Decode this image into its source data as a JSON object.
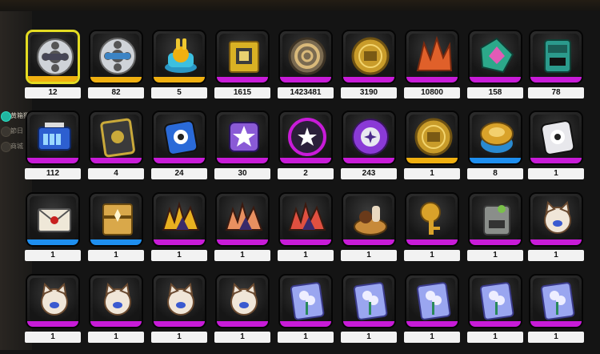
{
  "header": {
    "title": ""
  },
  "sidebar": {
    "items": [
      {
        "label": "黄箱獵人",
        "active": true,
        "icon": "teal-dot-icon"
      },
      {
        "label": "節日",
        "active": false,
        "icon": "dot-icon"
      },
      {
        "label": "商城",
        "active": false,
        "icon": "dot-icon"
      }
    ]
  },
  "colors": {
    "purple": "#c81bd8",
    "gold": "#f0b010",
    "blue": "#1e8ff0",
    "selected": "#e4dc22"
  },
  "inventory": {
    "items": [
      {
        "name": "film-reel-silver",
        "count": "12",
        "rarity": "gold",
        "selected": true,
        "icon": "film-reel-icon"
      },
      {
        "name": "film-reel-blue",
        "count": "82",
        "rarity": "gold",
        "icon": "film-reel-icon"
      },
      {
        "name": "bunny-cylinder",
        "count": "5",
        "rarity": "gold",
        "icon": "bunny-capsule-icon"
      },
      {
        "name": "gold-cube",
        "count": "1615",
        "rarity": "purple",
        "icon": "gold-cube-icon"
      },
      {
        "name": "spiral-coin",
        "count": "1423481",
        "rarity": "purple",
        "icon": "spiral-coin-icon"
      },
      {
        "name": "gold-coin",
        "count": "3190",
        "rarity": "purple",
        "icon": "gold-coin-icon"
      },
      {
        "name": "orange-crystal",
        "count": "10800",
        "rarity": "purple",
        "icon": "crystal-icon"
      },
      {
        "name": "teal-shard",
        "count": "158",
        "rarity": "purple",
        "icon": "shard-icon"
      },
      {
        "name": "teal-box",
        "count": "78",
        "rarity": "purple",
        "icon": "box-icon"
      },
      {
        "name": "battery-pack",
        "count": "112",
        "rarity": "purple",
        "icon": "battery-icon"
      },
      {
        "name": "dark-card",
        "count": "4",
        "rarity": "purple",
        "icon": "card-icon"
      },
      {
        "name": "blue-ticket",
        "count": "24",
        "rarity": "purple",
        "icon": "ticket-icon"
      },
      {
        "name": "star-cube",
        "count": "30",
        "rarity": "purple",
        "icon": "star-cube-icon"
      },
      {
        "name": "purple-disc",
        "count": "2",
        "rarity": "purple",
        "icon": "disc-icon"
      },
      {
        "name": "star-gear",
        "count": "243",
        "rarity": "purple",
        "icon": "gear-icon"
      },
      {
        "name": "hib-coin",
        "count": "1",
        "rarity": "gold",
        "icon": "gold-coin-icon"
      },
      {
        "name": "gold-can",
        "count": "8",
        "rarity": "blue",
        "icon": "can-icon"
      },
      {
        "name": "white-ticket",
        "count": "1",
        "rarity": "purple",
        "icon": "ticket-icon"
      },
      {
        "name": "envelope",
        "count": "1",
        "rarity": "blue",
        "icon": "envelope-icon"
      },
      {
        "name": "gold-chest",
        "count": "1",
        "rarity": "blue",
        "icon": "chest-icon"
      },
      {
        "name": "gold-wings",
        "count": "1",
        "rarity": "purple",
        "icon": "wings-icon"
      },
      {
        "name": "orange-wings",
        "count": "1",
        "rarity": "purple",
        "icon": "wings-icon"
      },
      {
        "name": "red-wings",
        "count": "1",
        "rarity": "purple",
        "icon": "wings-icon"
      },
      {
        "name": "cookie-basket",
        "count": "1",
        "rarity": "purple",
        "icon": "basket-icon"
      },
      {
        "name": "gold-key",
        "count": "1",
        "rarity": "purple",
        "icon": "key-icon"
      },
      {
        "name": "grey-bag",
        "count": "1",
        "rarity": "purple",
        "icon": "bag-icon"
      },
      {
        "name": "cat-police",
        "count": "1",
        "rarity": "purple",
        "icon": "cat-icon"
      },
      {
        "name": "cat-police-2",
        "count": "1",
        "rarity": "purple",
        "icon": "cat-icon"
      },
      {
        "name": "cat-face",
        "count": "1",
        "rarity": "purple",
        "icon": "cat-icon"
      },
      {
        "name": "cat-lock",
        "count": "1",
        "rarity": "purple",
        "icon": "cat-icon"
      },
      {
        "name": "cat-book",
        "count": "1",
        "rarity": "purple",
        "icon": "cat-icon"
      },
      {
        "name": "flower-card-1",
        "count": "1",
        "rarity": "purple",
        "icon": "flower-icon"
      },
      {
        "name": "flower-card-2",
        "count": "1",
        "rarity": "purple",
        "icon": "flower-icon"
      },
      {
        "name": "flower-card-3",
        "count": "1",
        "rarity": "purple",
        "icon": "flower-icon"
      },
      {
        "name": "flower-card-4",
        "count": "1",
        "rarity": "purple",
        "icon": "flower-icon"
      },
      {
        "name": "flower-card-5",
        "count": "1",
        "rarity": "purple",
        "icon": "flower-icon"
      }
    ]
  }
}
